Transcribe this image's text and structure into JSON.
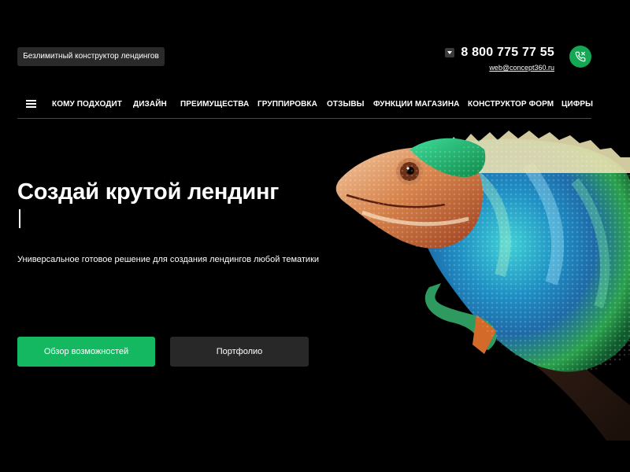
{
  "header": {
    "tagline": "Безлимитный конструктор лендингов",
    "phone": "8 800 775 77 55",
    "email": "web@concept360.ru"
  },
  "nav": {
    "items": [
      {
        "label": "КОМУ ПОДХОДИТ"
      },
      {
        "label": "ДИЗАЙН"
      },
      {
        "label": "ПРЕИМУЩЕСТВА"
      },
      {
        "label": "ГРУППИРОВКА"
      },
      {
        "label": "ОТЗЫВЫ"
      },
      {
        "label": "ФУНКЦИИ МАГАЗИНА"
      },
      {
        "label": "КОНСТРУКТОР ФОРМ"
      },
      {
        "label": "ЦИФРЫ"
      }
    ]
  },
  "hero": {
    "title": "Создай крутой лендинг",
    "subtitle": "Универсальное готовое решение для создания лендингов любой тематики",
    "primary_button": "Обзор возможностей",
    "secondary_button": "Портфолио"
  },
  "colors": {
    "background": "#000000",
    "accent_green": "#14b861",
    "call_button_green": "#14a754",
    "secondary_button": "#282828",
    "badge": "#2a2a2a"
  },
  "icons": {
    "menu": "hamburger-menu-icon",
    "phone_dropdown": "caret-down-icon",
    "call": "phone-call-icon"
  }
}
